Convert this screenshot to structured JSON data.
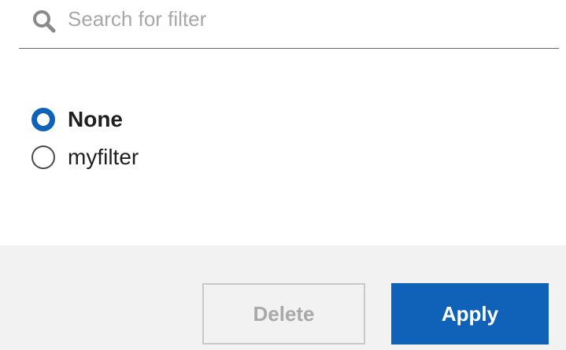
{
  "search": {
    "placeholder": "Search for filter",
    "value": ""
  },
  "filters": [
    {
      "label": "None",
      "selected": true
    },
    {
      "label": "myfilter",
      "selected": false
    }
  ],
  "actions": {
    "delete_label": "Delete",
    "delete_enabled": false,
    "apply_label": "Apply",
    "apply_enabled": true
  },
  "colors": {
    "accent": "#0f62b8",
    "footer_bg": "#f2f2f2",
    "disabled_text": "#a9a9a9",
    "placeholder_text": "#a8a8a8"
  },
  "icons": {
    "search": "search-icon"
  }
}
